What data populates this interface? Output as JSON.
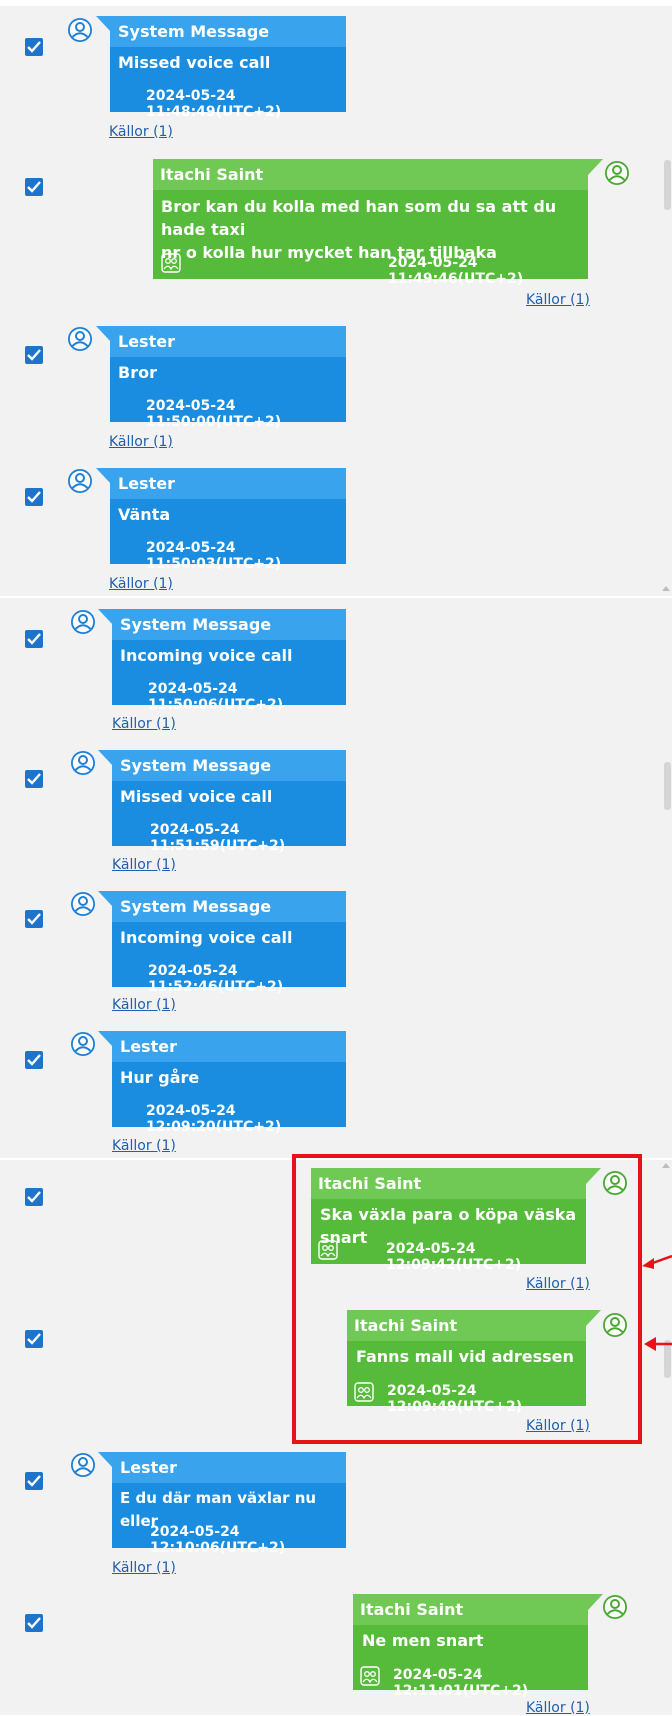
{
  "messages": [
    {
      "sender": "System Message",
      "text": "Missed voice call",
      "timestamp": "2024-05-24 11:48:49(UTC+2)",
      "sources": "Källor (1)"
    },
    {
      "sender": "Itachi Saint",
      "text_lines": [
        "Bror kan du kolla med han som du sa att du hade taxi",
        "nr o kolla hur mycket han tar tillbaka"
      ],
      "timestamp": "2024-05-24 11:49:46(UTC+2)",
      "sources": "Källor (1)"
    },
    {
      "sender": "Lester",
      "text": "Bror",
      "timestamp": "2024-05-24 11:50:00(UTC+2)",
      "sources": "Källor (1)"
    },
    {
      "sender": "Lester",
      "text": "Vänta",
      "timestamp": "2024-05-24 11:50:03(UTC+2)",
      "sources": "Källor (1)"
    },
    {
      "sender": "System Message",
      "text": "Incoming voice call",
      "timestamp": "2024-05-24 11:50:06(UTC+2)",
      "sources": "Källor (1)"
    },
    {
      "sender": "System Message",
      "text": "Missed voice call",
      "timestamp": "2024-05-24 11:51:59(UTC+2)",
      "sources": "Källor (1)"
    },
    {
      "sender": "System Message",
      "text": "Incoming voice call",
      "timestamp": "2024-05-24 11:52:46(UTC+2)",
      "sources": "Källor (1)"
    },
    {
      "sender": "Lester",
      "text": "Hur gåre",
      "timestamp": "2024-05-24 12:09:20(UTC+2)",
      "sources": "Källor (1)"
    },
    {
      "sender": "Itachi Saint",
      "text": "Ska växla para o köpa väska snart",
      "timestamp": "2024-05-24 12:09:42(UTC+2)",
      "sources": "Källor (1)"
    },
    {
      "sender": "Itachi Saint",
      "text": "Fanns mall vid adressen",
      "timestamp": "2024-05-24 12:09:49(UTC+2)",
      "sources": "Källor (1)"
    },
    {
      "sender": "Lester",
      "text": "E du där man växlar nu eller",
      "timestamp": "2024-05-24 12:10:06(UTC+2)",
      "sources": "Källor (1)"
    },
    {
      "sender": "Itachi Saint",
      "text": "Ne men snart",
      "timestamp": "2024-05-24 12:11:01(UTC+2)",
      "sources": "Källor (1)"
    }
  ],
  "checkbox_state": "checked",
  "icons": {
    "avatar": "person-avatar-icon",
    "group": "group-icon",
    "checkbox": "checkmark-icon"
  },
  "colors": {
    "system_bubble": "#1a8de0",
    "user_bubble": "#56bb3a",
    "highlight": "#e8121b",
    "link": "#1f5fae"
  }
}
